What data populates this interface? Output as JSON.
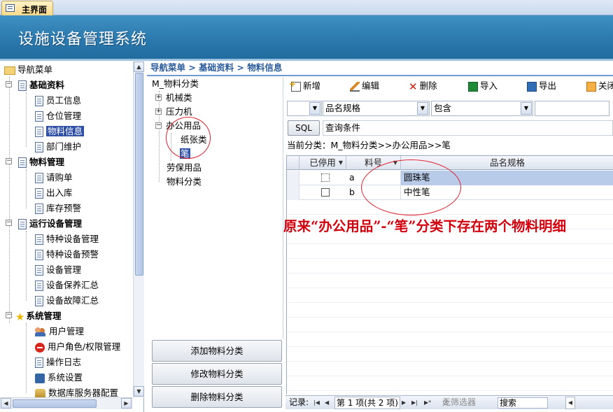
{
  "tab": {
    "label": "主界面",
    "icon": "form-icon"
  },
  "header": {
    "title": "设施设备管理系统"
  },
  "nav": {
    "root": "导航菜单",
    "groups": [
      {
        "label": "基础资料",
        "items": [
          "员工信息",
          "仓位管理",
          "物料信息",
          "部门维护"
        ]
      },
      {
        "label": "物料管理",
        "items": [
          "请购单",
          "出入库",
          "库存预警"
        ]
      },
      {
        "label": "运行设备管理",
        "items": [
          "特种设备管理",
          "特种设备预警",
          "设备管理",
          "设备保养汇总",
          "设备故障汇总"
        ]
      },
      {
        "label": "系统管理",
        "items": [
          "用户管理",
          "用户角色/权限管理",
          "操作日志",
          "系统设置",
          "数据库服务器配置"
        ]
      }
    ],
    "selected": "物料信息"
  },
  "breadcrumb": "导航菜单 > 基础资料 > 物料信息",
  "category_tree": {
    "root": "M_物料分类",
    "nodes": [
      "机械类",
      "压力机",
      "办公用品",
      "纸张类",
      "笔",
      "劳保用品",
      "物料分类"
    ],
    "selected": "笔"
  },
  "side_buttons": {
    "add": "添加物料分类",
    "edit": "修改物料分类",
    "delete": "删除物料分类"
  },
  "toolbar": {
    "new": "新增",
    "edit": "编辑",
    "delete": "删除",
    "import": "导入",
    "export": "导出",
    "close": "关闭"
  },
  "filter": {
    "field": "品名规格",
    "operator": "包含",
    "value": ""
  },
  "query": {
    "sql_label": "SQL",
    "condition_label": "查询条件"
  },
  "current_category": "当前分类：M_物料分类>>办公用品>>笔",
  "grid": {
    "columns": [
      "已停用",
      "料号",
      "品名规格"
    ],
    "rows": [
      {
        "disabled": false,
        "code": "a",
        "name": "圆珠笔"
      },
      {
        "disabled": false,
        "code": "b",
        "name": "中性笔"
      }
    ]
  },
  "annotation": "原来“办公用品”-“笔”分类下存在两个物料明细",
  "record_nav": {
    "label": "记录:",
    "position": "第 1 项(共 2 项)",
    "filter": "无筛选器",
    "search": "搜索"
  },
  "colors": {
    "header": "#2a78ad",
    "selected": "#3050a8",
    "annotation": "#d4000c"
  }
}
